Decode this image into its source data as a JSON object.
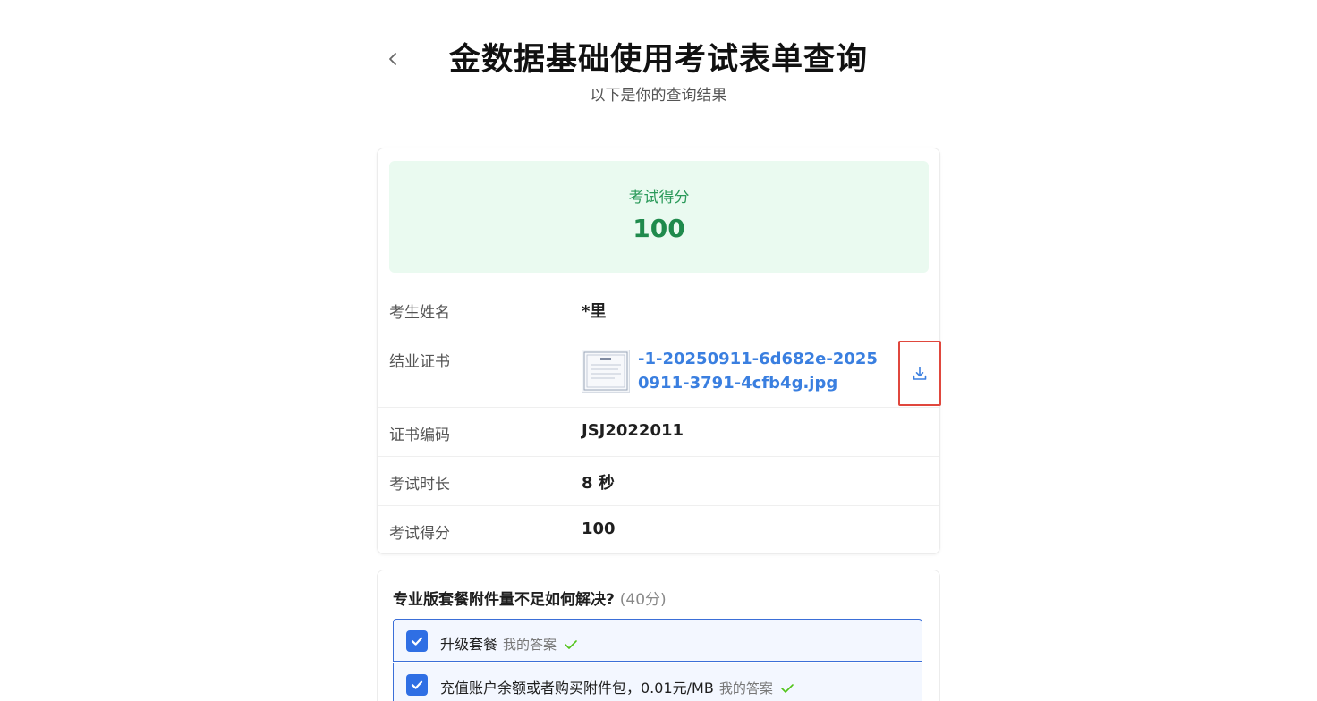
{
  "header": {
    "title": "金数据基础使用考试表单查询",
    "subtitle": "以下是你的查询结果"
  },
  "score_box": {
    "label": "考试得分",
    "value": "100"
  },
  "info_rows": {
    "name": {
      "label": "考生姓名",
      "value": "*里"
    },
    "certificate": {
      "label": "结业证书",
      "file_name": "-1-20250911-6d682e-20250911-3791-4cfb4g.jpg"
    },
    "cert_code": {
      "label": "证书编码",
      "value": "JSJ2022011"
    },
    "duration": {
      "label": "考试时长",
      "value": "8 秒"
    },
    "score": {
      "label": "考试得分",
      "value": "100"
    }
  },
  "question": {
    "title": "专业版套餐附件量不足如何解决?",
    "points": "(40分)",
    "options": [
      {
        "text": "升级套餐",
        "tag": "我的答案",
        "checked": true
      },
      {
        "text": "充值账户余额或者购买附件包，0.01元/MB",
        "tag": "我的答案",
        "checked": true
      }
    ]
  },
  "colors": {
    "accent_blue": "#2f6fe4",
    "link_blue": "#3a7fe0",
    "score_green": "#1f8a4c",
    "score_bg": "#eafaf0",
    "highlight_red": "#e0473d",
    "check_green": "#52c41a"
  },
  "icons": {
    "back": "chevron-left-icon",
    "download": "download-icon",
    "checkbox": "checkbox-checked-icon",
    "correct": "check-icon"
  }
}
